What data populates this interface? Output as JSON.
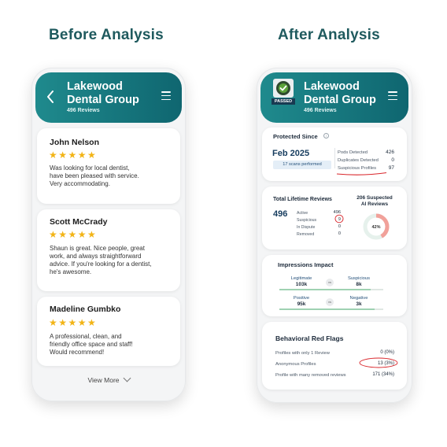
{
  "titles": {
    "before": "Before Analysis",
    "after": "After Analysis"
  },
  "business": {
    "name_line1": "Lakewood",
    "name_line2": "Dental Group",
    "reviews": "496 Reviews"
  },
  "reviews": [
    {
      "name": "John Nelson",
      "stars": "★★★★★",
      "text": [
        "Was looking for local dentist,",
        "have been pleased with service.",
        "Very accommodating."
      ]
    },
    {
      "name": "Scott McCrady",
      "stars": "★★★★★",
      "text": [
        "Shaun is great. Nice people, great",
        "work, and always straightforward",
        "advice. If you're looking for a dentist,",
        "he's awesome."
      ]
    },
    {
      "name": "Madeline Gumbko",
      "stars": "★★★★★",
      "text": [
        "A professional, clean, and",
        "friendly office space and staff!",
        "Would recommend!"
      ]
    }
  ],
  "view_more": "View More",
  "badge": {
    "label": "PASSED"
  },
  "protected": {
    "title": "Protected Since",
    "date": "Feb 2025",
    "scans": "17 scans performed",
    "rows": [
      {
        "label": "Pods Detected",
        "value": "426"
      },
      {
        "label": "Duplicates Detected",
        "value": "0"
      },
      {
        "label": "Suspicious Profiles",
        "value": "97"
      }
    ]
  },
  "lifetime": {
    "title": "Total Lifetime Reviews",
    "total": "496",
    "rows": [
      {
        "label": "Active",
        "value": "496"
      },
      {
        "label": "Suspicious",
        "value": "9"
      },
      {
        "label": "In Dispute",
        "value": "0"
      },
      {
        "label": "Removed",
        "value": "0"
      }
    ],
    "suspected_title_line1": "206 Suspected",
    "suspected_title_line2": "AI Reviews",
    "percent_label": "42%",
    "percent": 42
  },
  "impressions": {
    "title": "Impressions Impact",
    "vs": "vs",
    "rows": [
      {
        "left_label": "Legitimate",
        "left_value": "103k",
        "right_label": "Suspicious",
        "right_value": "8k"
      },
      {
        "left_label": "Positive",
        "left_value": "95k",
        "right_label": "Negative",
        "right_value": "3k"
      }
    ]
  },
  "flags": {
    "title": "Behavioral Red Flags",
    "rows": [
      {
        "label": "Profiles with only 1 Review",
        "value": "0 (0%)"
      },
      {
        "label": "Anonymous Profiles",
        "value": "13 (3%)"
      },
      {
        "label": "Profile with many removed reviews",
        "value": "171 (34%)"
      }
    ]
  },
  "colors": {
    "teal": "#1f8a8d",
    "star": "#f2b416",
    "alert": "#d9262b",
    "donut": "#f1a19a"
  }
}
